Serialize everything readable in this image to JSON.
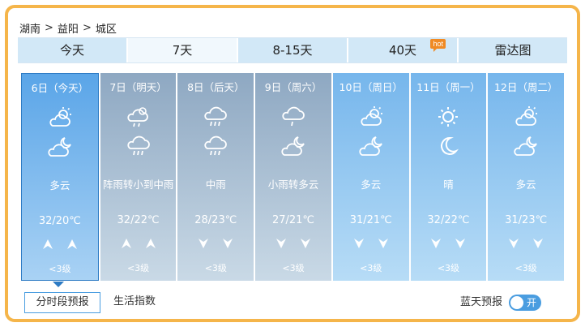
{
  "breadcrumb": [
    "湖南",
    "益阳",
    "城区"
  ],
  "breadcrumb_sep": ">",
  "tabs": [
    {
      "label": "今天"
    },
    {
      "label": "7天"
    },
    {
      "label": "8-15天"
    },
    {
      "label": "40天",
      "badge": "hot"
    },
    {
      "label": "雷达图"
    }
  ],
  "active_tab": "7天",
  "days": [
    {
      "date": "6日（今天）",
      "icons": [
        "partly-cloudy-day-icon",
        "partly-cloudy-night-icon"
      ],
      "desc": "多云",
      "temp": "32/20℃",
      "wind": [
        "up-arrow-icon",
        "up-arrow-icon"
      ],
      "level": "<3级"
    },
    {
      "date": "7日（明天）",
      "icons": [
        "shower-icon",
        "rain-icon"
      ],
      "desc": "阵雨转小到中雨",
      "temp": "32/22℃",
      "wind": [
        "up-arrow-icon",
        "up-arrow-icon"
      ],
      "level": "<3级"
    },
    {
      "date": "8日（后天）",
      "icons": [
        "rain-icon",
        "rain-icon"
      ],
      "desc": "中雨",
      "temp": "28/23℃",
      "wind": [
        "down-arrow-icon",
        "down-arrow-icon"
      ],
      "level": "<3级"
    },
    {
      "date": "9日（周六）",
      "icons": [
        "light-rain-icon",
        "partly-cloudy-night-icon"
      ],
      "desc": "小雨转多云",
      "temp": "27/21℃",
      "wind": [
        "down-arrow-icon",
        "down-arrow-icon"
      ],
      "level": "<3级"
    },
    {
      "date": "10日（周日）",
      "icons": [
        "partly-cloudy-day-icon",
        "partly-cloudy-night-icon"
      ],
      "desc": "多云",
      "temp": "31/21℃",
      "wind": [
        "down-arrow-icon",
        "down-arrow-icon"
      ],
      "level": "<3级"
    },
    {
      "date": "11日（周一）",
      "icons": [
        "sun-icon",
        "moon-icon"
      ],
      "desc": "晴",
      "temp": "32/22℃",
      "wind": [
        "down-arrow-icon",
        "down-arrow-icon"
      ],
      "level": "<3级"
    },
    {
      "date": "12日（周二）",
      "icons": [
        "partly-cloudy-day-icon",
        "partly-cloudy-night-icon"
      ],
      "desc": "多云",
      "temp": "31/23℃",
      "wind": [
        "down-arrow-icon",
        "down-arrow-icon"
      ],
      "level": "<3级"
    }
  ],
  "subtabs": {
    "active": "分时段预报",
    "other": "生活指数"
  },
  "bluesky": {
    "label": "蓝天预报",
    "toggle": "开"
  },
  "colors": {
    "frame": "#f5b54a",
    "tab_bg": "#d2e8f7",
    "day_card": "#76b6ec",
    "past_card": "#8ea8c2",
    "accent": "#4a9de0"
  }
}
